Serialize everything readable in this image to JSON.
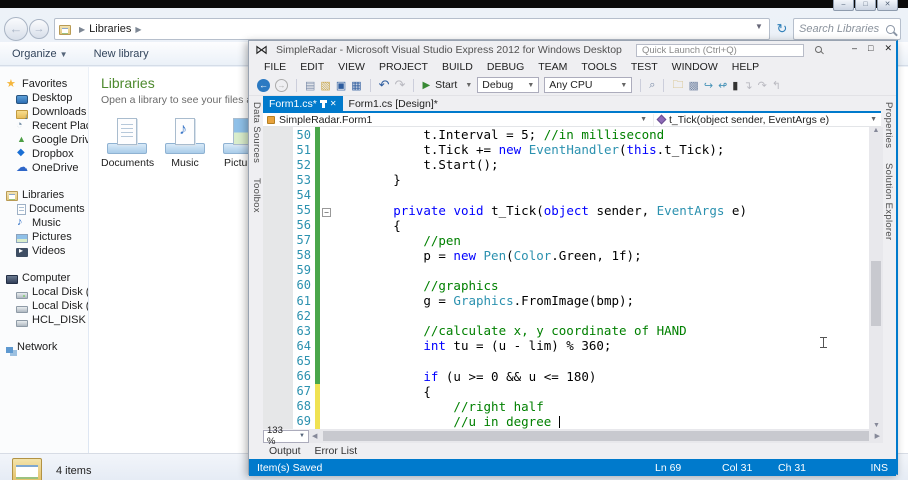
{
  "explorer": {
    "address": {
      "crumb": "Libraries",
      "search_placeholder": "Search Libraries"
    },
    "toolbar": {
      "organize_label": "Organize",
      "new_library_label": "New library"
    },
    "sidebar": [
      {
        "label": "Favorites",
        "icon": "star",
        "items": [
          {
            "label": "Desktop",
            "icon": "monitor"
          },
          {
            "label": "Downloads",
            "icon": "folder-down"
          },
          {
            "label": "Recent Places",
            "icon": "recent"
          },
          {
            "label": "Google Drive",
            "icon": "gdrive"
          },
          {
            "label": "Dropbox",
            "icon": "dropbox"
          },
          {
            "label": "OneDrive",
            "icon": "cloud"
          }
        ]
      },
      {
        "label": "Libraries",
        "icon": "library",
        "items": [
          {
            "label": "Documents",
            "icon": "doc"
          },
          {
            "label": "Music",
            "icon": "note"
          },
          {
            "label": "Pictures",
            "icon": "pic"
          },
          {
            "label": "Videos",
            "icon": "video"
          }
        ]
      },
      {
        "label": "Computer",
        "icon": "computer",
        "items": [
          {
            "label": "Local Disk (C:)",
            "icon": "disk"
          },
          {
            "label": "Local Disk (D:)",
            "icon": "disk2"
          },
          {
            "label": "HCL_DISK (E:)",
            "icon": "disk2"
          }
        ]
      },
      {
        "label": "Network",
        "icon": "network",
        "items": []
      }
    ],
    "main": {
      "title": "Libraries",
      "subtitle": "Open a library to see your files and arrange",
      "tiles": [
        {
          "label": "Documents",
          "icon": "doc"
        },
        {
          "label": "Music",
          "icon": "note"
        },
        {
          "label": "Pictures",
          "icon": "pic"
        }
      ]
    },
    "status": {
      "items_count": "4 items"
    }
  },
  "vs": {
    "title": "SimpleRadar - Microsoft Visual Studio Express 2012 for Windows Desktop",
    "quick_launch_placeholder": "Quick Launch (Ctrl+Q)",
    "menus": [
      "FILE",
      "EDIT",
      "VIEW",
      "PROJECT",
      "BUILD",
      "DEBUG",
      "TEAM",
      "TOOLS",
      "TEST",
      "WINDOW",
      "HELP"
    ],
    "toolbar": {
      "start_label": "Start",
      "configuration": "Debug",
      "platform": "Any CPU"
    },
    "doc_tabs": [
      {
        "label": "Form1.cs*",
        "active": true
      },
      {
        "label": "Form1.cs [Design]*",
        "active": false
      }
    ],
    "navbar": {
      "type_name": "SimpleRadar.Form1",
      "member_name": "t_Tick(object sender, EventArgs e)"
    },
    "left_tool_tabs": [
      "Data Sources",
      "Toolbox"
    ],
    "right_tool_tabs": [
      "Properties",
      "Solution Explorer"
    ],
    "editor": {
      "zoom_level": "133 %",
      "colors": {
        "keyword": "#0000ff",
        "type": "#2b91af",
        "comment": "#008000",
        "plain": "#000000",
        "line_number": "#2b91af",
        "change_saved": "#4aa64a",
        "change_unsaved": "#f0e252",
        "accent": "#007acc"
      },
      "lines": [
        {
          "n": 50,
          "ind": 12,
          "bar": "g",
          "tok": [
            [
              "p",
              "t.Interval = 5; "
            ],
            [
              "c",
              "//in millisecond"
            ]
          ]
        },
        {
          "n": 51,
          "ind": 12,
          "bar": "g",
          "tok": [
            [
              "p",
              "t.Tick += "
            ],
            [
              "k",
              "new"
            ],
            [
              "p",
              " "
            ],
            [
              "t",
              "EventHandler"
            ],
            [
              "p",
              "("
            ],
            [
              "k",
              "this"
            ],
            [
              "p",
              ".t_Tick);"
            ]
          ]
        },
        {
          "n": 52,
          "ind": 12,
          "bar": "g",
          "tok": [
            [
              "p",
              "t.Start();"
            ]
          ]
        },
        {
          "n": 53,
          "ind": 8,
          "bar": "g",
          "tok": [
            [
              "p",
              "}"
            ]
          ]
        },
        {
          "n": 54,
          "ind": 0,
          "bar": "g",
          "tok": []
        },
        {
          "n": 55,
          "ind": 8,
          "bar": "g",
          "fold": true,
          "tok": [
            [
              "k",
              "private"
            ],
            [
              "p",
              " "
            ],
            [
              "k",
              "void"
            ],
            [
              "p",
              " t_Tick("
            ],
            [
              "k",
              "object"
            ],
            [
              "p",
              " sender, "
            ],
            [
              "t",
              "EventArgs"
            ],
            [
              "p",
              " e)"
            ]
          ]
        },
        {
          "n": 56,
          "ind": 8,
          "bar": "g",
          "tok": [
            [
              "p",
              "{"
            ]
          ]
        },
        {
          "n": 57,
          "ind": 12,
          "bar": "g",
          "tok": [
            [
              "c",
              "//pen"
            ]
          ]
        },
        {
          "n": 58,
          "ind": 12,
          "bar": "g",
          "tok": [
            [
              "p",
              "p = "
            ],
            [
              "k",
              "new"
            ],
            [
              "p",
              " "
            ],
            [
              "t",
              "Pen"
            ],
            [
              "p",
              "("
            ],
            [
              "t",
              "Color"
            ],
            [
              "p",
              ".Green, 1f);"
            ]
          ]
        },
        {
          "n": 59,
          "ind": 0,
          "bar": "g",
          "tok": []
        },
        {
          "n": 60,
          "ind": 12,
          "bar": "g",
          "tok": [
            [
              "c",
              "//graphics"
            ]
          ]
        },
        {
          "n": 61,
          "ind": 12,
          "bar": "g",
          "tok": [
            [
              "p",
              "g = "
            ],
            [
              "t",
              "Graphics"
            ],
            [
              "p",
              ".FromImage(bmp);"
            ]
          ]
        },
        {
          "n": 62,
          "ind": 0,
          "bar": "g",
          "tok": []
        },
        {
          "n": 63,
          "ind": 12,
          "bar": "g",
          "tok": [
            [
              "c",
              "//calculate x, y coordinate of HAND"
            ]
          ]
        },
        {
          "n": 64,
          "ind": 12,
          "bar": "g",
          "tok": [
            [
              "k",
              "int"
            ],
            [
              "p",
              " tu = (u - lim) % 360;"
            ]
          ]
        },
        {
          "n": 65,
          "ind": 0,
          "bar": "g",
          "tok": []
        },
        {
          "n": 66,
          "ind": 12,
          "bar": "g",
          "tok": [
            [
              "k",
              "if"
            ],
            [
              "p",
              " (u >= 0 && u <= 180)"
            ]
          ]
        },
        {
          "n": 67,
          "ind": 12,
          "bar": "y",
          "tok": [
            [
              "p",
              "{"
            ]
          ]
        },
        {
          "n": 68,
          "ind": 16,
          "bar": "y",
          "tok": [
            [
              "c",
              "//right half"
            ]
          ]
        },
        {
          "n": 69,
          "ind": 16,
          "bar": "y",
          "caret": true,
          "tok": [
            [
              "c",
              "//u in degree "
            ]
          ]
        }
      ]
    },
    "bottom_tabs": [
      "Output",
      "Error List"
    ],
    "status": {
      "message": "Item(s) Saved",
      "line": "Ln 69",
      "column": "Col 31",
      "character": "Ch 31",
      "mode": "INS"
    }
  }
}
